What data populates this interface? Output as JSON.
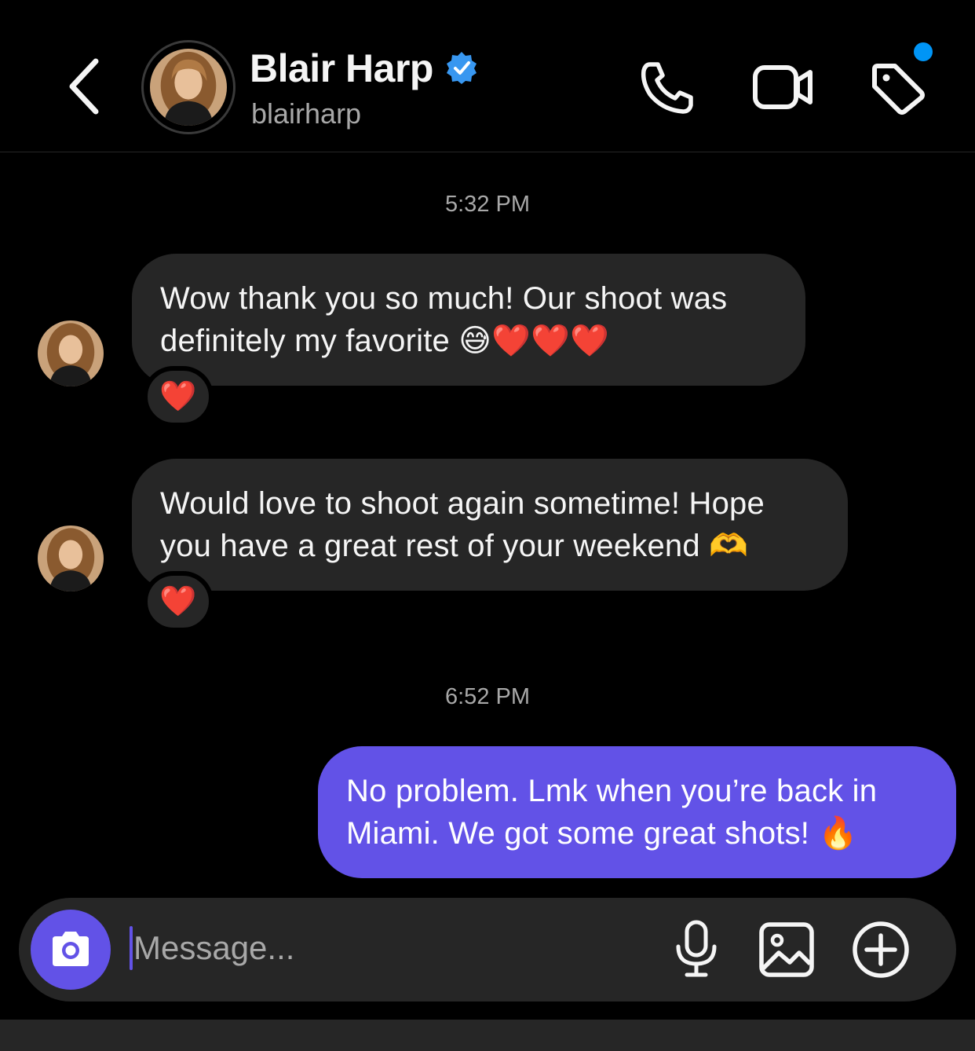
{
  "header": {
    "contact_name": "Blair Harp",
    "contact_handle": "blairharp",
    "verified": true,
    "icons": [
      "back-arrow-icon",
      "verified-badge-icon",
      "phone-icon",
      "video-camera-icon",
      "tag-icon"
    ],
    "notification_dot_color": "#0095f6"
  },
  "thread": {
    "timestamps": [
      "5:32 PM",
      "6:52 PM"
    ],
    "messages": [
      {
        "sender": "blairharp",
        "direction": "incoming",
        "lines": [
          "Wow thank you so much! Our shoot was",
          "definitely my favorite 😅❤️❤️❤️"
        ],
        "reaction": "❤️"
      },
      {
        "sender": "blairharp",
        "direction": "incoming",
        "lines": [
          "Would love to shoot again sometime! Hope",
          "you have a great rest of your weekend 🫶"
        ],
        "reaction": "❤️"
      },
      {
        "sender": "me",
        "direction": "outgoing",
        "lines": [
          "No problem. Lmk when you’re back in",
          "Miami. We got some great shots! 🔥"
        ]
      }
    ]
  },
  "composer": {
    "placeholder": "Message...",
    "value": "",
    "icons": [
      "camera-icon",
      "microphone-icon",
      "gallery-icon",
      "plus-circle-icon"
    ]
  },
  "colors": {
    "background": "#000000",
    "incoming_bubble": "#262626",
    "outgoing_bubble": "#6252e7",
    "secondary_text": "#a8a8a8",
    "accent": "#6252e7"
  }
}
